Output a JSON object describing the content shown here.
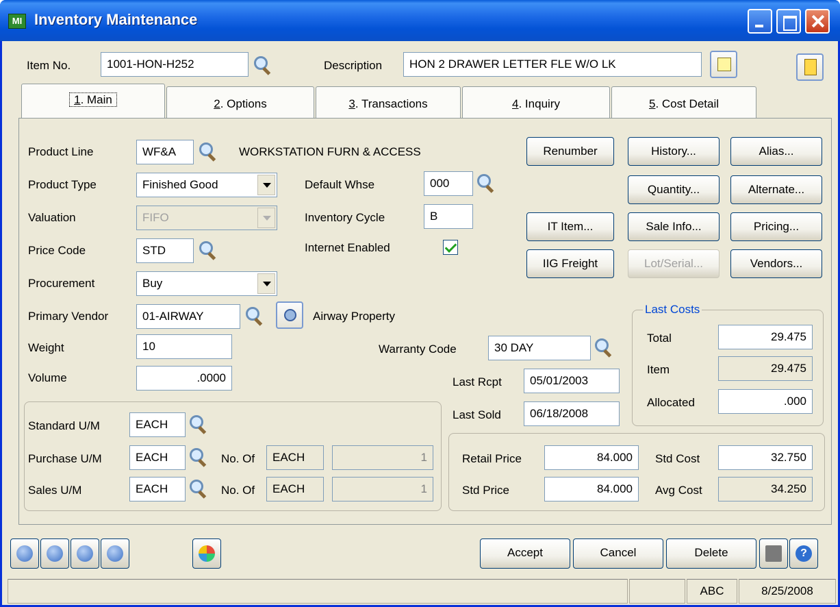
{
  "window": {
    "title": "Inventory Maintenance",
    "icon_text": "MI"
  },
  "header": {
    "item_no_label": "Item No.",
    "item_no_value": "1001-HON-H252",
    "description_label": "Description",
    "description_value": "HON 2 DRAWER LETTER FLE W/O LK"
  },
  "tabs": [
    {
      "label": "1. Main",
      "mnemonic": "1",
      "rest": ". Main"
    },
    {
      "label": "2. Options",
      "mnemonic": "2",
      "rest": ". Options"
    },
    {
      "label": "3. Transactions",
      "mnemonic": "3",
      "rest": ". Transactions"
    },
    {
      "label": "4. Inquiry",
      "mnemonic": "4",
      "rest": ". Inquiry"
    },
    {
      "label": "5. Cost Detail",
      "mnemonic": "5",
      "rest": ". Cost Detail"
    }
  ],
  "main": {
    "product_line_label": "Product Line",
    "product_line_value": "WF&A",
    "product_line_desc": "WORKSTATION FURN & ACCESS",
    "product_type_label": "Product Type",
    "product_type_value": "Finished Good",
    "valuation_label": "Valuation",
    "valuation_value": "FIFO",
    "price_code_label": "Price Code",
    "price_code_value": "STD",
    "procurement_label": "Procurement",
    "procurement_value": "Buy",
    "primary_vendor_label": "Primary Vendor",
    "primary_vendor_value": "01-AIRWAY",
    "primary_vendor_name": "Airway Property",
    "weight_label": "Weight",
    "weight_value": "10",
    "volume_label": "Volume",
    "volume_value": ".0000",
    "default_whse_label": "Default Whse",
    "default_whse_value": "000",
    "inventory_cycle_label": "Inventory Cycle",
    "inventory_cycle_value": "B",
    "internet_enabled_label": "Internet Enabled",
    "internet_enabled": true,
    "warranty_code_label": "Warranty Code",
    "warranty_code_value": "30 DAY",
    "last_rcpt_label": "Last Rcpt",
    "last_rcpt_value": "05/01/2003",
    "last_sold_label": "Last Sold",
    "last_sold_value": "06/18/2008"
  },
  "buttons": {
    "renumber": "Renumber",
    "history": "History...",
    "alias": "Alias...",
    "quantity": "Quantity...",
    "alternate": "Alternate...",
    "it_item": "IT Item...",
    "sale_info": "Sale Info...",
    "pricing": "Pricing...",
    "iig_freight": "IIG Freight",
    "lot_serial": "Lot/Serial...",
    "vendors": "Vendors..."
  },
  "last_costs": {
    "title": "Last Costs",
    "total_label": "Total",
    "total_value": "29.475",
    "item_label": "Item",
    "item_value": "29.475",
    "allocated_label": "Allocated",
    "allocated_value": ".000"
  },
  "um": {
    "standard_label": "Standard U/M",
    "standard_value": "EACH",
    "purchase_label": "Purchase U/M",
    "purchase_value": "EACH",
    "purchase_no_of_label": "No. Of",
    "purchase_no_of_unit": "EACH",
    "purchase_no_of_value": "1",
    "sales_label": "Sales U/M",
    "sales_value": "EACH",
    "sales_no_of_label": "No. Of",
    "sales_no_of_unit": "EACH",
    "sales_no_of_value": "1"
  },
  "pricing": {
    "retail_price_label": "Retail Price",
    "retail_price_value": "84.000",
    "std_price_label": "Std Price",
    "std_price_value": "84.000",
    "std_cost_label": "Std Cost",
    "std_cost_value": "32.750",
    "avg_cost_label": "Avg Cost",
    "avg_cost_value": "34.250"
  },
  "footer": {
    "accept": "Accept",
    "cancel": "Cancel",
    "delete": "Delete"
  },
  "statusbar": {
    "company": "ABC",
    "date": "8/25/2008"
  },
  "colors": {
    "titlebar": "#0453d6",
    "window_bg": "#ece9d8",
    "group_title": "#0046d5"
  }
}
